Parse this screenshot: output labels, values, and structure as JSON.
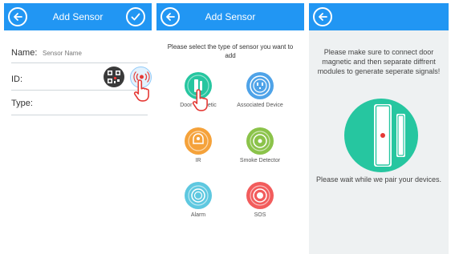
{
  "screen1": {
    "title": "Add Sensor",
    "back_icon": "arrow-left-icon",
    "confirm_icon": "check-icon",
    "name_label": "Name:",
    "name_placeholder": "Sensor Name",
    "id_label": "ID:",
    "type_label": "Type:",
    "qr_icon": "qr-code-icon",
    "scan_icon": "wireless-scan-icon"
  },
  "screen2": {
    "title": "Add Sensor",
    "instruction": "Please select the type of sensor you want to add",
    "sensors": [
      {
        "label": "Door Magnetic",
        "color": "#26c6a0"
      },
      {
        "label": "Associated Device",
        "color": "#4fa3e8"
      },
      {
        "label": "IR",
        "color": "#f5a23a"
      },
      {
        "label": "Smoke Detector",
        "color": "#8bc34a"
      },
      {
        "label": "Alarm",
        "color": "#5ec8e0"
      },
      {
        "label": "SOS",
        "color": "#f25c5c"
      }
    ]
  },
  "screen3": {
    "message": "Please make sure to connect door magnetic and then separate diffrent modules to generate seperate signals!",
    "wait_text": "Please wait while we pair your devices.",
    "accent_color": "#26c6a0"
  },
  "colors": {
    "header": "#2196f3",
    "hand_cursor": "#e53935"
  }
}
